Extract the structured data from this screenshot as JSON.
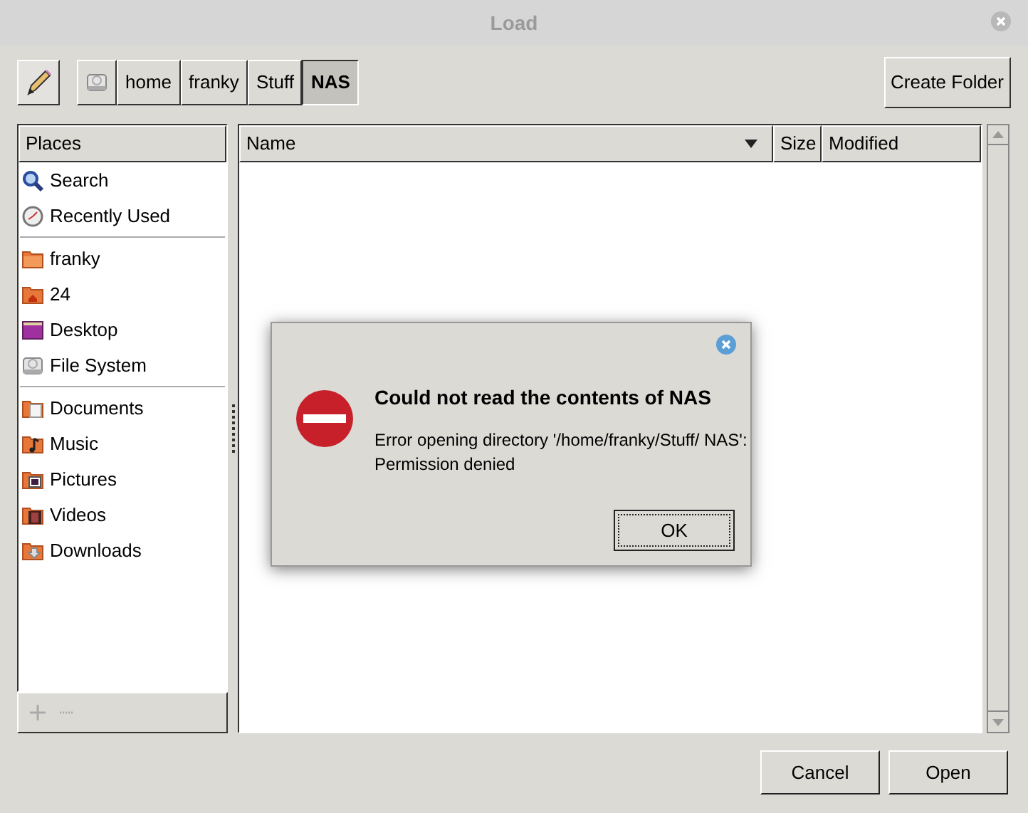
{
  "window": {
    "title": "Load"
  },
  "toolbar": {
    "path": [
      {
        "kind": "drive",
        "selected": false
      },
      {
        "label": "home",
        "selected": false
      },
      {
        "label": "franky",
        "selected": false
      },
      {
        "label": "Stuff",
        "selected": false
      },
      {
        "label": "NAS",
        "selected": true
      }
    ],
    "create_folder": "Create Folder"
  },
  "places": {
    "header": "Places",
    "sections": [
      [
        {
          "label": "Search",
          "kind": "search"
        },
        {
          "label": "Recently Used",
          "kind": "recent"
        }
      ],
      [
        {
          "label": "franky",
          "kind": "folder"
        },
        {
          "label": "24",
          "kind": "home-folder"
        },
        {
          "label": "Desktop",
          "kind": "desktop"
        },
        {
          "label": "File System",
          "kind": "drive"
        }
      ],
      [
        {
          "label": "Documents",
          "kind": "folder-doc"
        },
        {
          "label": "Music",
          "kind": "folder-music"
        },
        {
          "label": "Pictures",
          "kind": "folder-pic"
        },
        {
          "label": "Videos",
          "kind": "folder-video"
        },
        {
          "label": "Downloads",
          "kind": "folder-down"
        }
      ]
    ],
    "add_disabled": true,
    "remove_disabled": true
  },
  "files": {
    "columns": [
      "Name",
      "Size",
      "Modified"
    ]
  },
  "dialog": {
    "title": "Could not read the contents of NAS",
    "message": "Error opening directory '/home/franky/Stuff/ NAS': Permission denied",
    "button": "OK"
  },
  "buttons": [
    "Cancel",
    "Open"
  ]
}
